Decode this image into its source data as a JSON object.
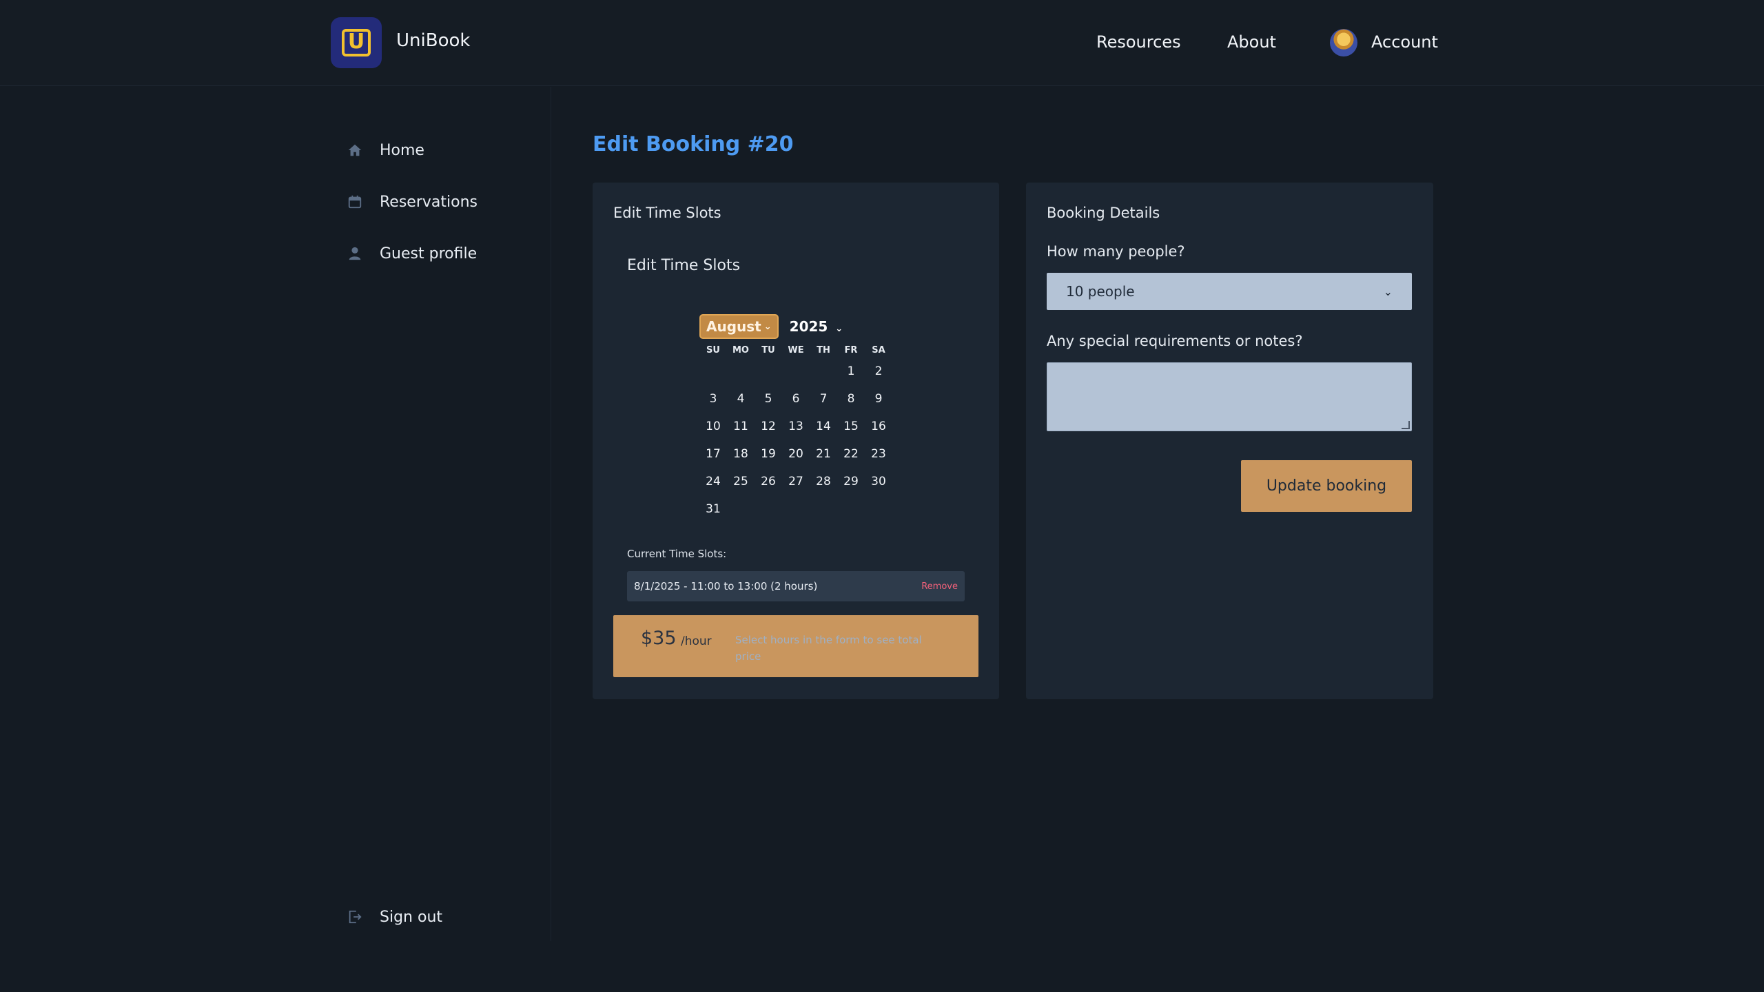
{
  "header": {
    "brand": "UniBook",
    "nav": [
      "Resources",
      "About",
      "Account"
    ]
  },
  "sidebar": {
    "items": [
      {
        "label": "Home",
        "icon": "home-icon"
      },
      {
        "label": "Reservations",
        "icon": "calendar-icon"
      },
      {
        "label": "Guest profile",
        "icon": "user-icon"
      }
    ],
    "signout": {
      "label": "Sign out",
      "icon": "sign-out-icon"
    }
  },
  "main": {
    "title": "Edit Booking #20",
    "left_panel": {
      "heading": "Edit Time Slots",
      "subheading": "Edit Time Slots",
      "calendar": {
        "month": "August",
        "year": "2025",
        "weekdays": [
          "SU",
          "MO",
          "TU",
          "WE",
          "TH",
          "FR",
          "SA"
        ],
        "weeks": [
          [
            "",
            "",
            "",
            "",
            "",
            "1",
            "2"
          ],
          [
            "3",
            "4",
            "5",
            "6",
            "7",
            "8",
            "9"
          ],
          [
            "10",
            "11",
            "12",
            "13",
            "14",
            "15",
            "16"
          ],
          [
            "17",
            "18",
            "19",
            "20",
            "21",
            "22",
            "23"
          ],
          [
            "24",
            "25",
            "26",
            "27",
            "28",
            "29",
            "30"
          ],
          [
            "31",
            "",
            "",
            "",
            "",
            "",
            ""
          ]
        ]
      },
      "slots_label": "Current Time Slots:",
      "slots": [
        {
          "text": "8/1/2025 - 11:00 to 13:00 (2 hours)",
          "remove": "Remove"
        }
      ],
      "price": {
        "amount": "$35",
        "unit": "/hour",
        "hint": "Select hours in the form to see total price"
      }
    },
    "right_panel": {
      "heading": "Booking Details",
      "people_label": "How many people?",
      "people_value": "10 people",
      "notes_label": "Any special requirements or notes?",
      "notes_value": "",
      "update_button": "Update booking"
    }
  },
  "colors": {
    "background": "#141b23",
    "panel": "#1c2632",
    "accent_title": "#4e9bf2",
    "button": "#c9965e",
    "input": "#b4c3d6",
    "logo_bg": "#232b7a",
    "logo_fg": "#f2c12e",
    "remove": "#f2617a"
  }
}
